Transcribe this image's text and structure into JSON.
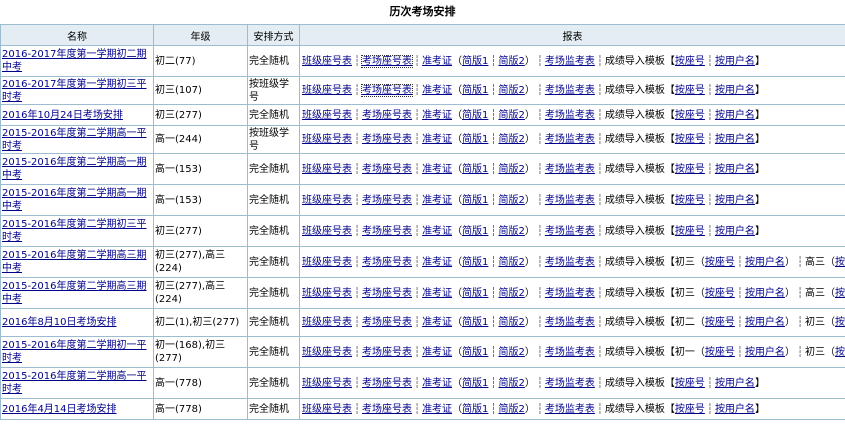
{
  "page_title": "历次考场安排",
  "headers": {
    "name": "名称",
    "grade": "年级",
    "method": "安排方式",
    "report": "报表"
  },
  "report_labels": {
    "class_seat": "班级座号表",
    "room_seat": "考场座号表",
    "admission": "准考证",
    "v1": "简版1",
    "v2": "简版2",
    "proctor": "考场监考表",
    "import_tpl": "成绩导入模板",
    "by_seat": "按座号",
    "by_user": "按用户名"
  },
  "rows": [
    {
      "name": "2016-2017年度第一学期初二期中考",
      "grade": "初二(77)",
      "method": "完全随机",
      "height": 31,
      "import": [
        "",
        ""
      ]
    },
    {
      "name": "2016-2017年度第一学期初三平时考",
      "grade": "初三(107)",
      "method": "按班级学号",
      "height": 28,
      "import": [
        "",
        ""
      ]
    },
    {
      "name": "2016年10月24日考场安排",
      "grade": "初三(277)",
      "method": "完全随机",
      "height": 21,
      "import": [
        "",
        ""
      ]
    },
    {
      "name": "2015-2016年度第二学期高一平时考",
      "grade": "高一(244)",
      "method": "按班级学号",
      "height": 28,
      "import": [
        "",
        ""
      ]
    },
    {
      "name": "2015-2016年度第二学期高一期中考",
      "grade": "高一(153)",
      "method": "完全随机",
      "height": 31,
      "import": [
        "",
        ""
      ]
    },
    {
      "name": "2015-2016年度第二学期高一期中考",
      "grade": "高一(153)",
      "method": "完全随机",
      "height": 31,
      "import": [
        "",
        ""
      ]
    },
    {
      "name": "2015-2016年度第二学期初三平时考",
      "grade": "初三(277)",
      "method": "完全随机",
      "height": 31,
      "import": [
        "",
        ""
      ]
    },
    {
      "name": "2015-2016年度第二学期高三期中考",
      "grade": "初三(277),高三(224)",
      "method": "完全随机",
      "height": 31,
      "import": [
        "初三",
        "高三"
      ]
    },
    {
      "name": "2015-2016年度第二学期高三期中考",
      "grade": "初三(277),高三(224)",
      "method": "完全随机",
      "height": 31,
      "import": [
        "初三",
        "高三"
      ]
    },
    {
      "name": "2016年8月10日考场安排",
      "grade": "初二(1),初三(277)",
      "method": "完全随机",
      "height": 28,
      "import": [
        "初二",
        "初三"
      ]
    },
    {
      "name": "2015-2016年度第二学期初一平时考",
      "grade": "初一(168),初三(277)",
      "method": "完全随机",
      "height": 31,
      "import": [
        "初一",
        "初三"
      ]
    },
    {
      "name": "2015-2016年度第二学期高一平时考",
      "grade": "高一(778)",
      "method": "完全随机",
      "height": 31,
      "import": [
        "",
        ""
      ]
    },
    {
      "name": "2016年4月14日考场安排",
      "grade": "高一(778)",
      "method": "完全随机",
      "height": 21,
      "import": [
        "",
        ""
      ]
    }
  ]
}
